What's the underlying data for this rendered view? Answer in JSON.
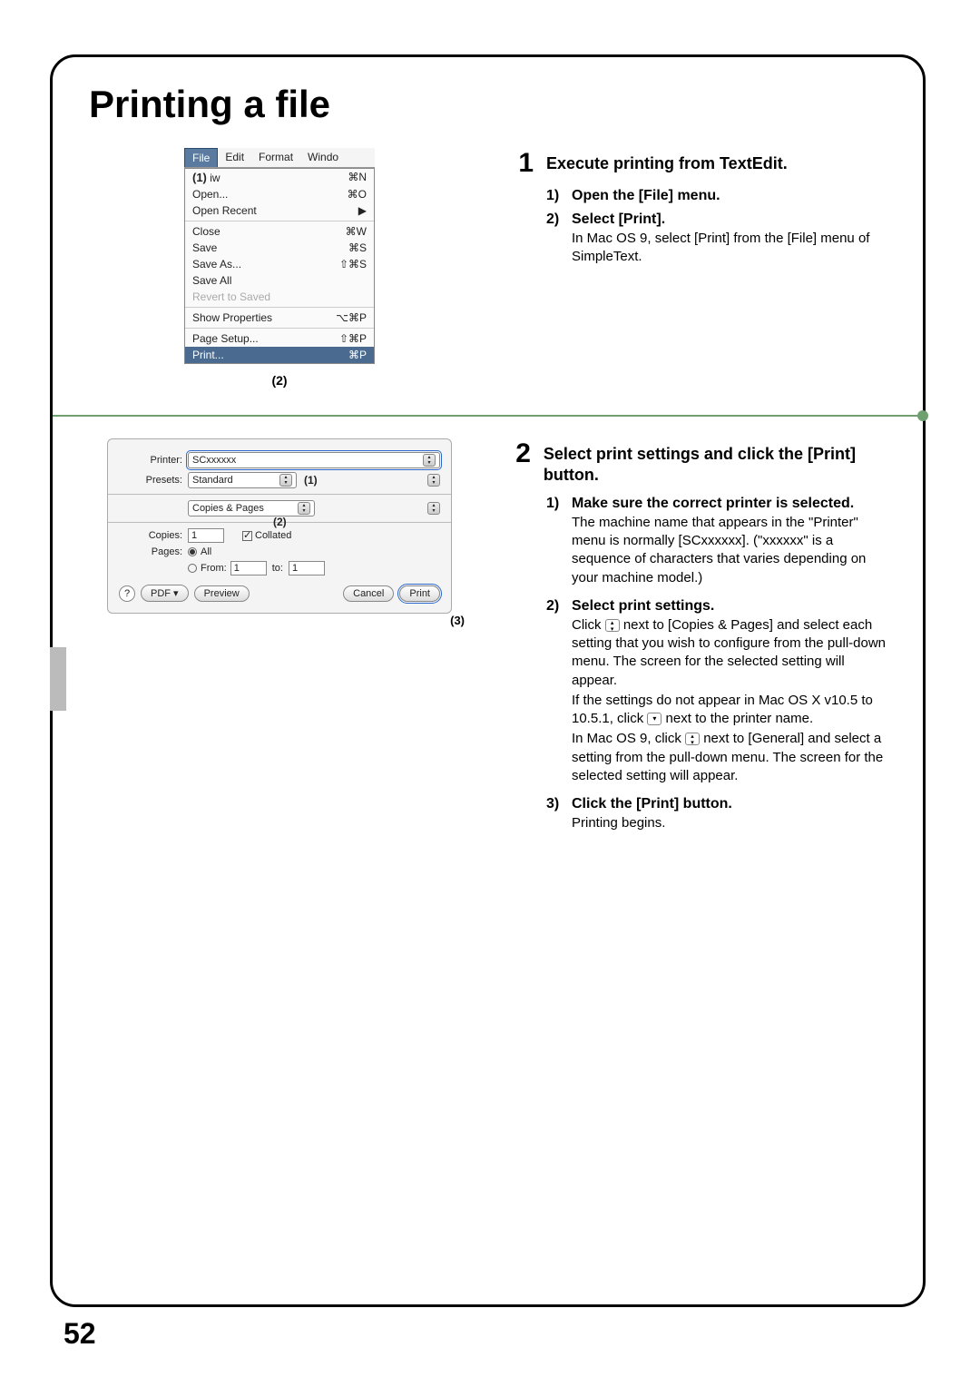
{
  "page": {
    "title": "Printing a file",
    "number": "52"
  },
  "step1": {
    "num": "1",
    "heading": "Execute printing from TextEdit.",
    "items": [
      {
        "num": "1)",
        "head": "Open the [File] menu."
      },
      {
        "num": "2)",
        "head": "Select [Print]."
      }
    ],
    "note": "In Mac OS 9, select [Print] from the [File] menu of SimpleText."
  },
  "filemenu": {
    "menubar": [
      "File",
      "Edit",
      "Format",
      "Windo"
    ],
    "callout1": "(1)",
    "rows": [
      {
        "label": "iw",
        "short": "⌘N"
      },
      {
        "label": "Open...",
        "short": "⌘O"
      },
      {
        "label": "Open Recent",
        "short": "▶"
      },
      {
        "sep": true
      },
      {
        "label": "Close",
        "short": "⌘W"
      },
      {
        "label": "Save",
        "short": "⌘S"
      },
      {
        "label": "Save As...",
        "short": "⇧⌘S"
      },
      {
        "label": "Save All",
        "short": ""
      },
      {
        "label": "Revert to Saved",
        "short": "",
        "disabled": true
      },
      {
        "sep": true
      },
      {
        "label": "Show Properties",
        "short": "⌥⌘P"
      },
      {
        "sep": true
      },
      {
        "label": "Page Setup...",
        "short": "⇧⌘P"
      },
      {
        "label": "Print...",
        "short": "⌘P",
        "highlight": true
      }
    ],
    "callout2": "(2)"
  },
  "step2": {
    "num": "2",
    "heading": "Select print settings and click the [Print] button.",
    "items": [
      {
        "num": "1)",
        "head": "Make sure the correct printer is selected.",
        "body": "The machine name that appears in the \"Printer\" menu is normally [SCxxxxxx]. (\"xxxxxx\" is a sequence of characters that varies depending on your machine model.)"
      },
      {
        "num": "2)",
        "head": "Select print settings.",
        "body_a": "Click ",
        "body_b": " next to [Copies & Pages] and select each setting that you wish to configure from the pull-down menu. The screen for the selected setting will appear.",
        "body_c": "If the settings do not appear in Mac OS X v10.5 to 10.5.1, click ",
        "body_d": " next to the printer name.",
        "body_e": "In Mac OS 9, click ",
        "body_f": " next to [General] and select a setting from the pull-down menu. The screen for the selected setting will appear."
      },
      {
        "num": "3)",
        "head": "Click the [Print] button.",
        "body": "Printing begins."
      }
    ]
  },
  "printdlg": {
    "printer_label": "Printer:",
    "printer_value": "SCxxxxxx",
    "presets_label": "Presets:",
    "presets_value": "Standard",
    "section_value": "Copies & Pages",
    "copies_label": "Copies:",
    "copies_value": "1",
    "collated_label": "Collated",
    "pages_label": "Pages:",
    "all_label": "All",
    "from_label": "From:",
    "from_value": "1",
    "to_label": "to:",
    "to_value": "1",
    "help": "?",
    "pdf": "PDF ▾",
    "preview": "Preview",
    "cancel": "Cancel",
    "print": "Print",
    "annot1": "(1)",
    "annot2": "(2)",
    "annot3": "(3)"
  }
}
